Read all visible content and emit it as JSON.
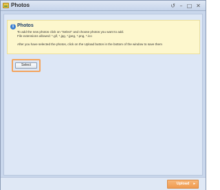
{
  "window": {
    "title": "Photos",
    "icon": "photo-gallery-icon",
    "controls": {
      "restore": "↺",
      "minimize": "–",
      "maximize": "□",
      "close": "✕"
    }
  },
  "info": {
    "icon": "info-icon",
    "icon_glyph": "i",
    "title": "Photos",
    "lines": [
      "To add the new photos click on \"Select\" and choose photos you want to add.",
      "File extensions allowed: *.gif, *.jpg, *.jpeg, *.png, *.ico",
      "After you have selected the photos, click on the Upload button in the bottom of the window to save them"
    ]
  },
  "actions": {
    "select_label": "Select",
    "upload_label": "Upload",
    "upload_arrow": "▸"
  },
  "colors": {
    "accent_orange": "#f4a35a",
    "info_background": "#fdf7cd",
    "panel_background": "#dde7f6"
  }
}
